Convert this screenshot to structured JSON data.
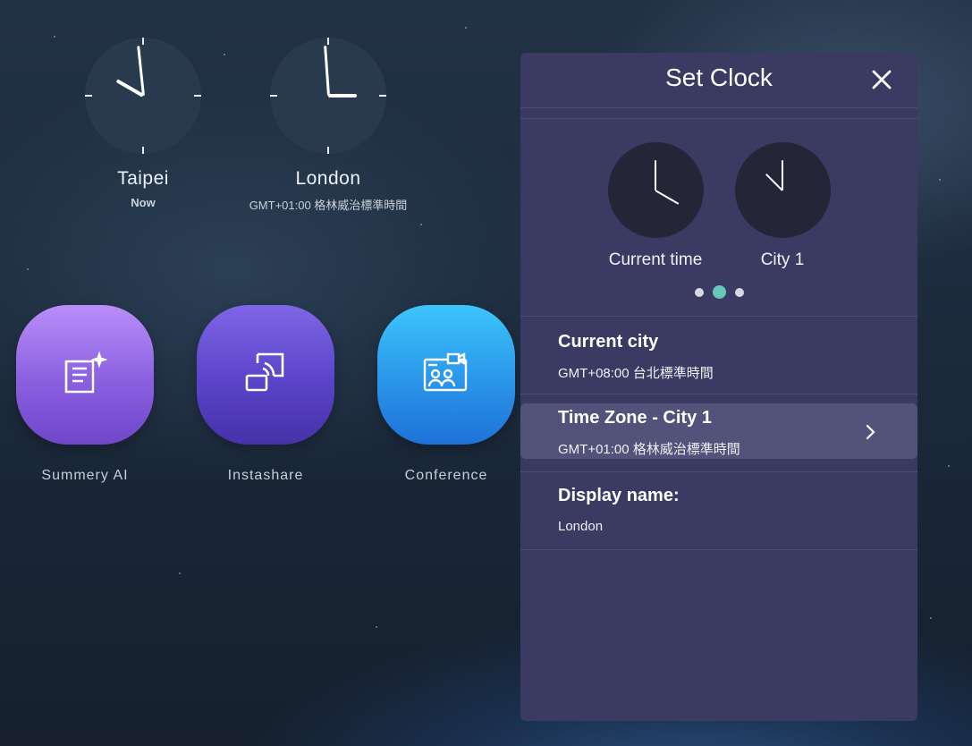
{
  "world_clocks": [
    {
      "city": "Taipei",
      "subtitle": "Now"
    },
    {
      "city": "London",
      "subtitle": "GMT+01:00 格林威治標準時間"
    }
  ],
  "apps": [
    {
      "label": "Summery AI",
      "icon": "summary-ai-icon",
      "color": "#9a6ee0"
    },
    {
      "label": "Instashare",
      "icon": "instashare-icon",
      "color": "#6a4fcf"
    },
    {
      "label": "Conference",
      "icon": "conference-icon",
      "color": "#2a9fec"
    }
  ],
  "panel": {
    "title": "Set Clock",
    "close_icon": "close-icon",
    "clocks": [
      {
        "label": "Current time"
      },
      {
        "label": "City 1"
      }
    ],
    "pager": {
      "pages": 3,
      "active": 2,
      "active_color": "#68c8b8"
    },
    "current_city": {
      "title": "Current city",
      "value": "GMT+08:00 台北標準時間"
    },
    "time_zone": {
      "title": "Time Zone - City 1",
      "value": "GMT+01:00 格林威治標準時間"
    },
    "display_name": {
      "title": "Display name:",
      "value": "London"
    }
  },
  "colors": {
    "panel_bg": "#3a3a63",
    "highlight_row": "#52527a",
    "accent": "#68c8b8"
  }
}
